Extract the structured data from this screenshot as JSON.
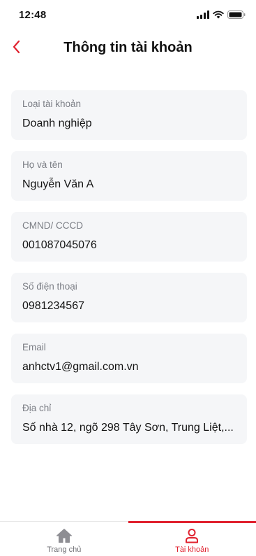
{
  "status_bar": {
    "time": "12:48"
  },
  "header": {
    "title": "Thông tin tài khoản"
  },
  "fields": [
    {
      "label": "Loại tài khoản",
      "value": "Doanh nghiệp"
    },
    {
      "label": "Họ và tên",
      "value": "Nguyễn Văn A"
    },
    {
      "label": "CMND/ CCCD",
      "value": "001087045076"
    },
    {
      "label": "Số điện thoại",
      "value": "0981234567"
    },
    {
      "label": "Email",
      "value": "anhctv1@gmail.com.vn"
    },
    {
      "label": "Địa chỉ",
      "value": "Số nhà 12, ngõ 298 Tây Sơn, Trung Liệt,..."
    }
  ],
  "tab_bar": {
    "home_label": "Trang chủ",
    "account_label": "Tài khoản",
    "active_tab": "account"
  },
  "colors": {
    "accent": "#e0212e",
    "card_bg": "#f5f6f8",
    "label": "#7b7e85"
  },
  "icons": {
    "back": "chevron-left-icon",
    "home": "home-icon",
    "account": "user-icon",
    "signal": "signal-icon",
    "wifi": "wifi-icon",
    "battery": "battery-icon"
  }
}
